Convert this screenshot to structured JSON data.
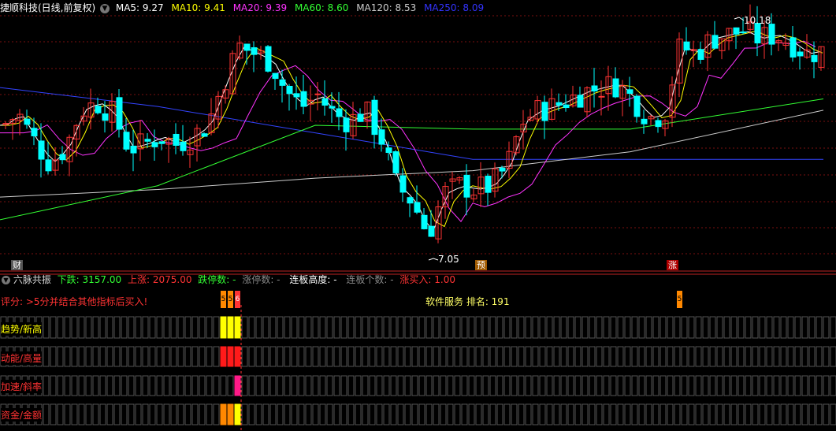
{
  "header": {
    "title": "捷顺科技(日线,前复权)",
    "ma": [
      {
        "label": "MA5: 9.27",
        "color": "#ffffff"
      },
      {
        "label": "MA10: 9.41",
        "color": "#ffff00"
      },
      {
        "label": "MA20: 9.39",
        "color": "#ff33ff"
      },
      {
        "label": "MA60: 8.60",
        "color": "#33ff33"
      },
      {
        "label": "MA120: 8.53",
        "color": "#cccccc"
      },
      {
        "label": "MA250: 8.09",
        "color": "#3333ff"
      }
    ]
  },
  "chart": {
    "high_label": "10.18",
    "low_label": "7.05",
    "markers": {
      "cai": "财",
      "yu": "预",
      "zhang": "涨"
    }
  },
  "indicator": {
    "name": "六脉共振",
    "stats": [
      {
        "text": "下跌: 3157.00",
        "color": "#33ff33"
      },
      {
        "text": "上涨: 2075.00",
        "color": "#ff3333"
      },
      {
        "text": "跌停数: -",
        "color": "#33ff33"
      },
      {
        "text": "涨停数: -",
        "color": "#888888"
      },
      {
        "text": "连板高度: -",
        "color": "#ffffff"
      },
      {
        "text": "连板个数: -",
        "color": "#888888"
      },
      {
        "text": "涨买入: 1.00",
        "color": "#ff3333"
      }
    ],
    "score_text": "评分: >5分并结合其他指标后买入!",
    "service_text": "软件服务 排名: 191",
    "badges": [
      "5",
      "5",
      "6",
      "5"
    ],
    "rows": [
      {
        "label": "趋势/新高",
        "color": "#ffff00"
      },
      {
        "label": "动能/高量",
        "color": "#ff3333"
      },
      {
        "label": "加速/斜率",
        "color": "#ff3333"
      },
      {
        "label": "资金/金额",
        "color": "#ff3333"
      }
    ]
  },
  "colors": {
    "up": "#ff3333",
    "down": "#00ffff",
    "grid": "#7a1010",
    "bar_empty": "#555555"
  }
}
